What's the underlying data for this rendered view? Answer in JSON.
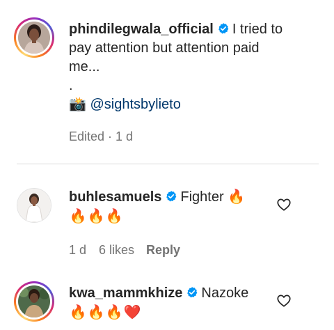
{
  "comments": [
    {
      "username": "phindilegwala_official",
      "text_line1": "I tried to",
      "text_line2": "pay attention but attention paid",
      "text_line3": "me...",
      "dot": ".",
      "camera_emoji": "📸",
      "mention": "@sightsbylieto",
      "meta": "Edited · 1 d"
    },
    {
      "username": "buhlesamuels",
      "text": "Fighter",
      "inline_emoji": "🔥",
      "emoji_line": [
        "🔥",
        "🔥",
        "🔥"
      ],
      "time": "1 d",
      "likes": "6 likes",
      "reply_label": "Reply"
    },
    {
      "username": "kwa_mammkhize",
      "text": "Nazoke",
      "emoji_line": [
        "🔥",
        "🔥",
        "🔥",
        "❤️"
      ]
    }
  ],
  "colors": {
    "verified_blue": "#0095f6",
    "mention_blue": "#00376b",
    "meta_gray": "#737373",
    "text": "#262626"
  },
  "icons": {
    "verified": "verified-badge-icon",
    "like": "heart-outline-icon"
  }
}
